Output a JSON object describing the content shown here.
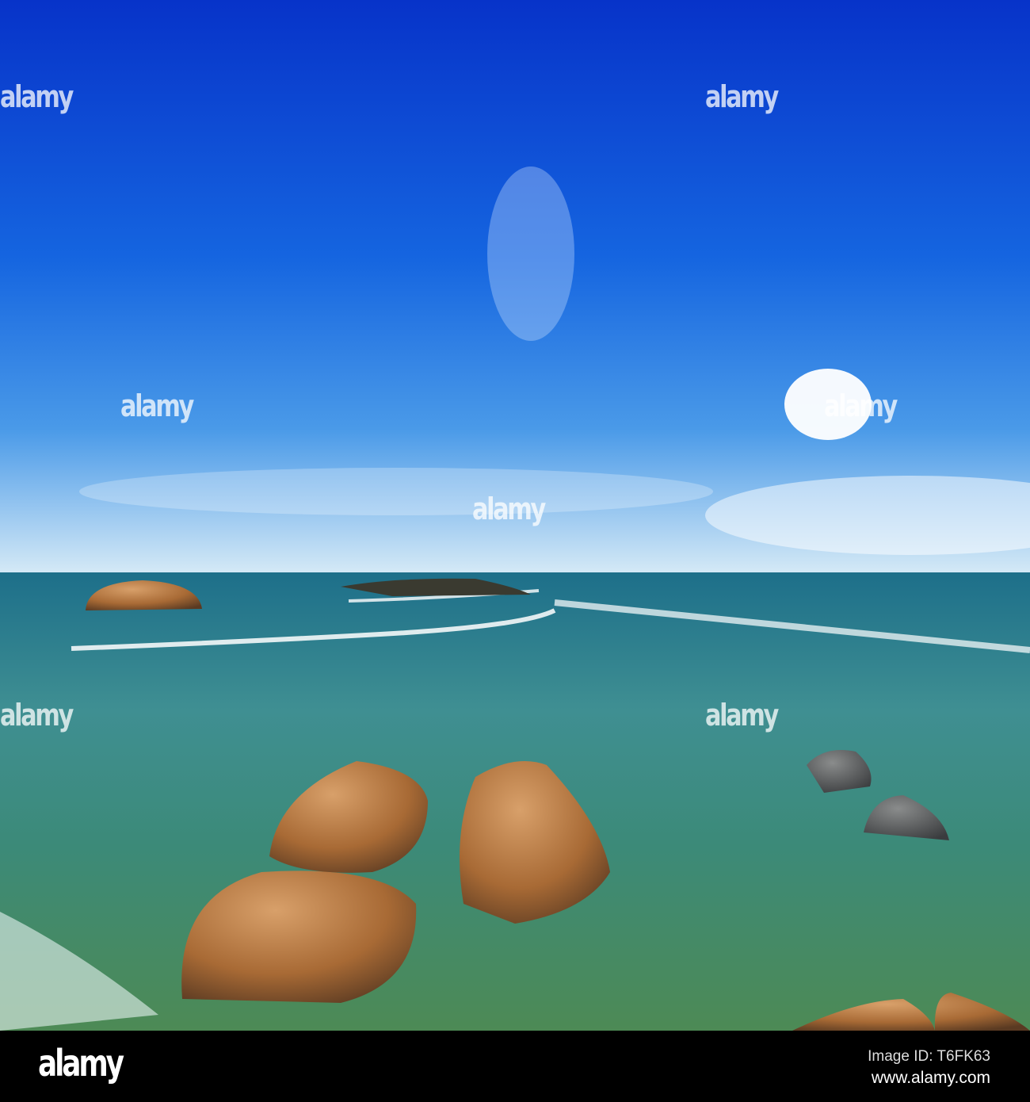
{
  "watermark": {
    "text": "alamy"
  },
  "footer": {
    "logo": "alamy",
    "image_id": "Image ID: T6FK63",
    "url": "www.alamy.com"
  },
  "colors": {
    "sky_top": "#0a3fd6",
    "sky_horizon": "#cfe6f7",
    "sea": "#2f8a80",
    "rock": "#b07a45"
  }
}
